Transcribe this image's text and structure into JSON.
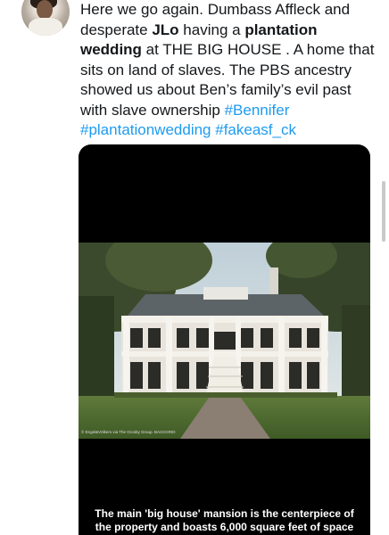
{
  "tweet": {
    "line1": "Here we go again. Dumbass Affleck and",
    "line2_pre": "desperate ",
    "line2_bold": "JLo",
    "line2_post": " having a ",
    "line2_bold2": "plantation",
    "line3_bold": "wedding",
    "line3_post": " at THE BIG HOUSE . A home that",
    "line4": "sits on land of slaves. The PBS ancestry",
    "line5": "showed us about Ben’s family’s evil past",
    "line6_pre": "with slave ownership ",
    "tag1": "#Bennifer",
    "tag2": "#plantationwedding",
    "tag3": "#fakeasf_ck"
  },
  "media": {
    "credit": "© Engel&Völkers via The Grosby Group. BACKGRID",
    "caption_line1": "The main 'big house' mansion is the centerpiece of",
    "caption_line2": "the property and boasts 6,000 square feet of space"
  },
  "colors": {
    "link": "#1d9bf0",
    "text": "#14171a",
    "media_bg": "#000000"
  }
}
